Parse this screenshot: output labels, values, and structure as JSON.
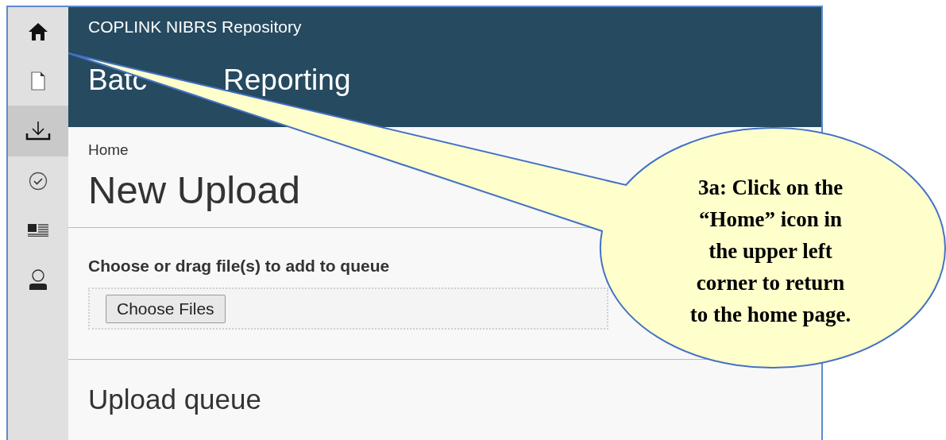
{
  "sidebar": {
    "items": [
      {
        "kind": "home",
        "selected": false
      },
      {
        "kind": "document",
        "selected": false
      },
      {
        "kind": "download",
        "selected": true
      },
      {
        "kind": "check",
        "selected": false
      },
      {
        "kind": "news",
        "selected": false
      },
      {
        "kind": "user",
        "selected": false
      }
    ]
  },
  "header": {
    "app_name": "COPLINK NIBRS Repository",
    "title_parts": [
      "Batc",
      "Reporting"
    ]
  },
  "breadcrumb": "Home",
  "page_title": "New Upload",
  "upload": {
    "label": "Choose or drag file(s) to add to queue",
    "button": "Choose Files"
  },
  "queue": {
    "title": "Upload queue"
  },
  "callout": {
    "lines": [
      "3a: Click on the",
      "“Home” icon in",
      "the upper left",
      "corner to return",
      "to the home page."
    ]
  }
}
